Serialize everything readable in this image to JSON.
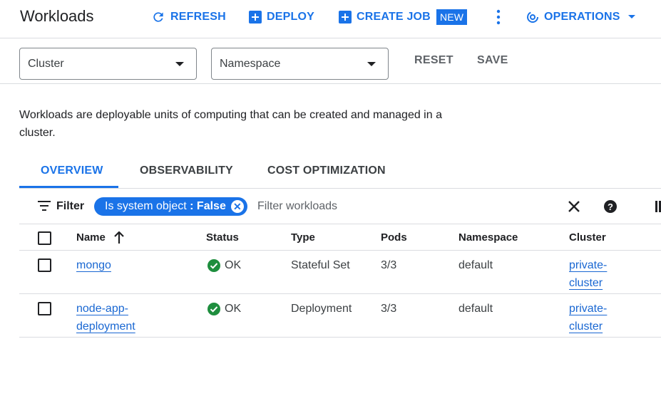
{
  "header": {
    "title": "Workloads",
    "refresh_label": "REFRESH",
    "deploy_label": "DEPLOY",
    "create_job_label": "CREATE JOB",
    "new_badge": "NEW",
    "operations_label": "OPERATIONS"
  },
  "filters": {
    "cluster_label": "Cluster",
    "namespace_label": "Namespace",
    "reset_label": "RESET",
    "save_label": "SAVE"
  },
  "description": "Workloads are deployable units of computing that can be created and managed in a cluster.",
  "tabs": [
    {
      "label": "OVERVIEW",
      "active": true
    },
    {
      "label": "OBSERVABILITY",
      "active": false
    },
    {
      "label": "COST OPTIMIZATION",
      "active": false
    }
  ],
  "table_filter": {
    "label": "Filter",
    "chip_key": "Is system object",
    "chip_sep": " : ",
    "chip_value": "False",
    "placeholder": "Filter workloads"
  },
  "table": {
    "columns": [
      "Name",
      "Status",
      "Type",
      "Pods",
      "Namespace",
      "Cluster"
    ],
    "rows": [
      {
        "name": "mongo",
        "status": "OK",
        "type": "Stateful Set",
        "pods": "3/3",
        "namespace": "default",
        "cluster": "private-cluster"
      },
      {
        "name": "node-app-deployment",
        "status": "OK",
        "type": "Deployment",
        "pods": "3/3",
        "namespace": "default",
        "cluster": "private-cluster"
      }
    ]
  },
  "colors": {
    "accent": "#1a73e8",
    "ok_green": "#1e8e3e",
    "link": "#1967d2"
  }
}
